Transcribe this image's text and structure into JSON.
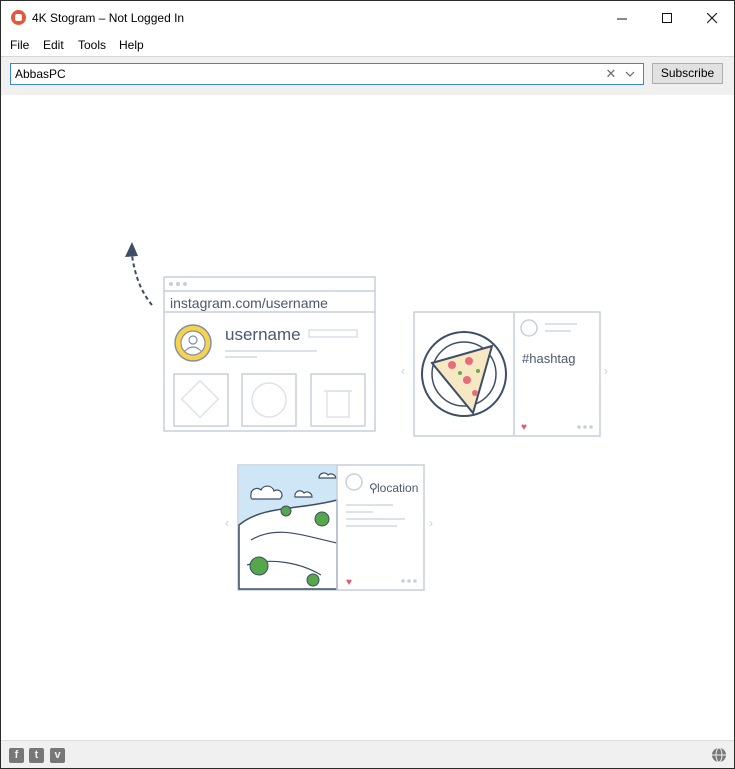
{
  "window": {
    "title": "4K Stogram – Not Logged In"
  },
  "menu": {
    "items": [
      "File",
      "Edit",
      "Tools",
      "Help"
    ]
  },
  "search": {
    "value": "AbbasPC"
  },
  "toolbar": {
    "subscribe_label": "Subscribe"
  },
  "illustration": {
    "url_text": "instagram.com/username",
    "username_text": "username",
    "hashtag_text": "#hashtag",
    "location_text": "location"
  },
  "footer": {
    "icons": [
      "facebook-icon",
      "twitter-icon",
      "vimeo-icon",
      "globe-icon"
    ]
  }
}
